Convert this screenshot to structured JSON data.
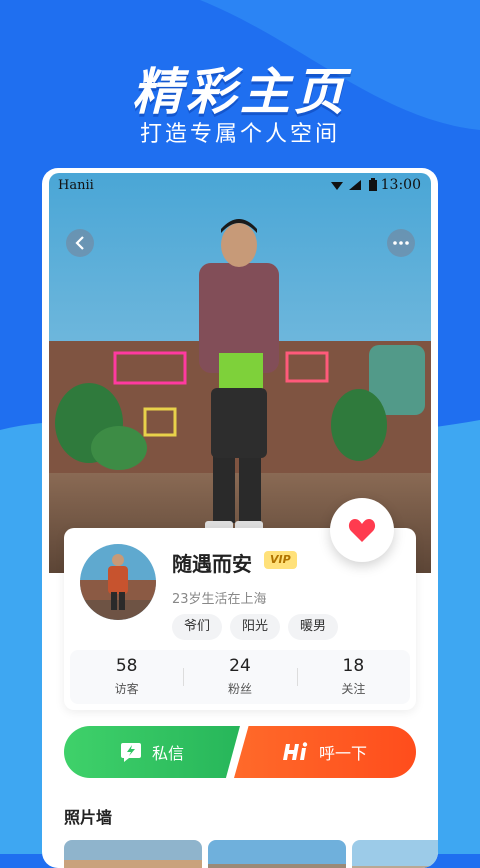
{
  "hero": {
    "title": "精彩主页",
    "subtitle": "打造专属个人空间"
  },
  "status_bar": {
    "app_name": "Hanii",
    "time": "13:00"
  },
  "profile": {
    "nickname": "随遇而安",
    "vip_badge": "VIP",
    "bio": "23岁生活在上海",
    "tags": [
      "爷们",
      "阳光",
      "暖男"
    ]
  },
  "stats": [
    {
      "value": "58",
      "label": "访客"
    },
    {
      "value": "24",
      "label": "粉丝"
    },
    {
      "value": "18",
      "label": "关注"
    }
  ],
  "actions": {
    "message_label": "私信",
    "hi_label": "呼一下"
  },
  "photo_wall": {
    "title": "照片墙"
  },
  "colors": {
    "background": "#1f6ff0",
    "message_green": "#2fc463",
    "hi_orange": "#ff5a22",
    "heart_red": "#ff3b4f",
    "vip_gold": "#ffe17a"
  }
}
